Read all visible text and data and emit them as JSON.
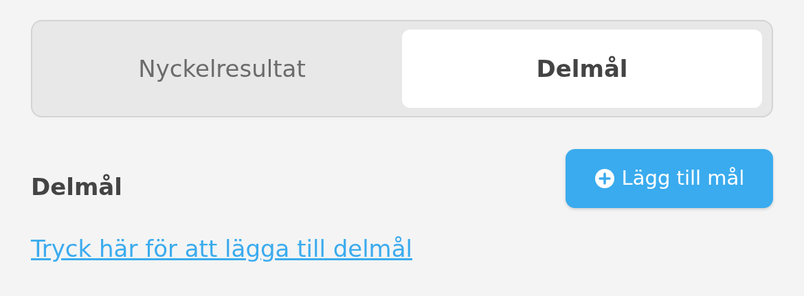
{
  "tabs": [
    {
      "label": "Nyckelresultat",
      "selected": false
    },
    {
      "label": "Delmål",
      "selected": true
    }
  ],
  "section": {
    "title": "Delmål",
    "add_button": "Lägg till mål",
    "empty_link": "Tryck här för att lägga till delmål"
  }
}
